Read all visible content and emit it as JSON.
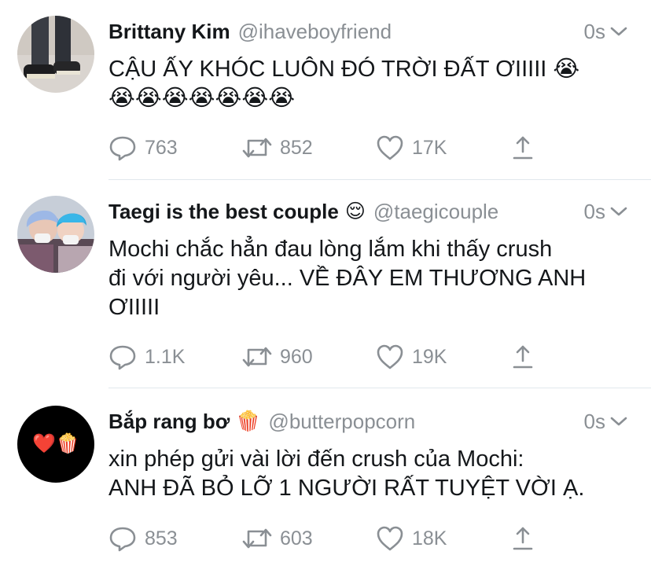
{
  "tweets": [
    {
      "name": "Brittany Kim",
      "name_emoji": "",
      "handle": "@ihaveboyfriend",
      "time": "0s",
      "text": "CẬU ẤY KHÓC LUÔN ĐÓ TRỜI ĐẤT ƠIIIII 😭\n😭😭😭😭😭😭😭",
      "replies": "763",
      "retweets": "852",
      "likes": "17K"
    },
    {
      "name": "Taegi is the best couple",
      "name_emoji": "😌",
      "handle": "@taegicouple",
      "time": "0s",
      "text": "Mochi chắc hẳn đau lòng lắm khi thấy crush\nđi với người yêu... VỀ ĐÂY EM THƯƠNG ANH\nƠIIIII",
      "replies": "1.1K",
      "retweets": "960",
      "likes": "19K"
    },
    {
      "name": "Bắp rang bơ",
      "name_emoji": "🍿",
      "handle": "@butterpopcorn",
      "time": "0s",
      "text": "xin phép gửi vài lời đến crush của Mochi:\nANH ĐÃ BỎ LỠ 1 NGƯỜI RẤT TUYỆT VỜI Ạ.",
      "replies": "853",
      "retweets": "603",
      "likes": "18K"
    }
  ],
  "avatar3_emojis": "❤️🍿",
  "colors": {
    "text": "#14171a",
    "secondary": "#8a8f94",
    "divider": "#e1e8ed"
  },
  "icons": [
    "reply-icon",
    "retweet-icon",
    "like-icon",
    "share-icon",
    "chevron-down-icon"
  ]
}
